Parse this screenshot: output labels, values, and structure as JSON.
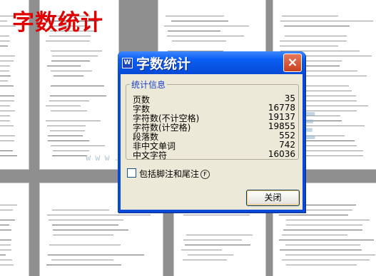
{
  "overlay_heading": "字数统计",
  "watermark": {
    "logo_text": "文库",
    "url": "www.renrendoc.com"
  },
  "dialog": {
    "app_icon": "W",
    "title": "字数统计",
    "close_icon": "×",
    "group_label": "统计信息",
    "stats": [
      {
        "label": "页数",
        "value": "35"
      },
      {
        "label": "字数",
        "value": "16778"
      },
      {
        "label": "字符数(不计空格)",
        "value": "19137"
      },
      {
        "label": "字符数(计空格)",
        "value": "19855"
      },
      {
        "label": "段落数",
        "value": "552"
      },
      {
        "label": "非中文单词",
        "value": "742"
      },
      {
        "label": "中文字符",
        "value": "16036"
      }
    ],
    "checkbox_label": "包括脚注和尾注",
    "checkbox_hotkey": "F",
    "checkbox_checked": false,
    "close_button_label": "关闭"
  }
}
